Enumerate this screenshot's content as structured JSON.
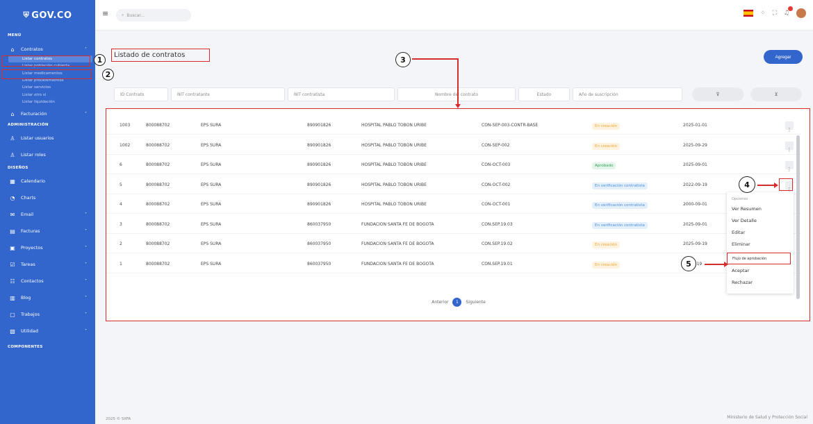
{
  "brand": {
    "name": "GOV.CO",
    "icon": "gov-shield-icon"
  },
  "sidebar": {
    "sections": {
      "menu": "MENÚ",
      "admin": "ADMINISTRACIÓN",
      "designs": "DISEÑOS",
      "components": "COMPONENTES"
    },
    "contratos": "Contratos",
    "subitems": [
      "Listar contratos",
      "Listar población cubierta",
      "Listar medicamentos",
      "Listar procedimientos",
      "Listar servicios",
      "Listar otro si",
      "Listar liquidación"
    ],
    "facturacion": "Facturación",
    "admin_items": [
      "Listar usuarios",
      "Listar roles"
    ],
    "design_items": [
      "Calendario",
      "Charts",
      "Email",
      "Facturas",
      "Proyectos",
      "Tareas",
      "Contactos",
      "Blog",
      "Trabajos",
      "Utilidad"
    ]
  },
  "topbar": {
    "search_placeholder": "Buscar..."
  },
  "page": {
    "title": "Listado de contratos",
    "add_button": "Agregar"
  },
  "filters": [
    "ID Contrato",
    "NIT contratante",
    "NIT contratista",
    "Nombre del contrato",
    "Estado",
    "Año de suscripción"
  ],
  "table": {
    "rows": [
      {
        "id": "1003",
        "nit1": "800088702",
        "contratante": "EPS SURA",
        "nit2": "890901826",
        "nombre": "HOSPITAL PABLO TOBON URIBE",
        "codigo": "CON-SEP-003-CONTR-BASE",
        "estado": "En creación",
        "estado_color": "#f0a63a",
        "estado_bg": "#fff3df",
        "fecha": "2025-01-01"
      },
      {
        "id": "1002",
        "nit1": "800088702",
        "contratante": "EPS SURA",
        "nit2": "890901826",
        "nombre": "HOSPITAL PABLO TOBON URIBE",
        "codigo": "CON-SEP-002",
        "estado": "En creación",
        "estado_color": "#f0a63a",
        "estado_bg": "#fff3df",
        "fecha": "2025-09-29"
      },
      {
        "id": "6",
        "nit1": "800088702",
        "contratante": "EPS SURA",
        "nit2": "890901826",
        "nombre": "HOSPITAL PABLO TOBON URIBE",
        "codigo": "CON-OCT-003",
        "estado": "Aprobado",
        "estado_color": "#3aa35c",
        "estado_bg": "#e3f5e9",
        "fecha": "2025-09-01"
      },
      {
        "id": "5",
        "nit1": "800088702",
        "contratante": "EPS SURA",
        "nit2": "890901826",
        "nombre": "HOSPITAL PABLO TOBON URIBE",
        "codigo": "CON-OCT-002",
        "estado": "En verificación contratista",
        "estado_color": "#4a8fe0",
        "estado_bg": "#e4effc",
        "fecha": "2022-09-19"
      },
      {
        "id": "4",
        "nit1": "800088702",
        "contratante": "EPS SURA",
        "nit2": "890901826",
        "nombre": "HOSPITAL PABLO TOBON URIBE",
        "codigo": "CON-OCT-001",
        "estado": "En verificación contratista",
        "estado_color": "#4a8fe0",
        "estado_bg": "#e4effc",
        "fecha": "2000-09-01"
      },
      {
        "id": "3",
        "nit1": "800088702",
        "contratante": "EPS SURA",
        "nit2": "860037950",
        "nombre": "FUNDACION SANTA FE DE BOGOTA",
        "codigo": "CON.SEP.19.03",
        "estado": "En verificación contratista",
        "estado_color": "#4a8fe0",
        "estado_bg": "#e4effc",
        "fecha": "2025-09-01"
      },
      {
        "id": "2",
        "nit1": "800088702",
        "contratante": "EPS SURA",
        "nit2": "860037950",
        "nombre": "FUNDACION SANTA FE DE BOGOTA",
        "codigo": "CON.SEP.19.02",
        "estado": "En creación",
        "estado_color": "#f0a63a",
        "estado_bg": "#fff3df",
        "fecha": "2025-09-19"
      },
      {
        "id": "1",
        "nit1": "800088702",
        "contratante": "EPS SURA",
        "nit2": "860037950",
        "nombre": "FUNDACION SANTA FE DE BOGOTA",
        "codigo": "CON.SEP.19.01",
        "estado": "En creación",
        "estado_color": "#f0a63a",
        "estado_bg": "#fff3df",
        "fecha": "25-09-19"
      }
    ]
  },
  "pager": {
    "prev": "Anterior",
    "page": "1",
    "next": "Siguiente"
  },
  "dropdown": {
    "header": "Opciones",
    "items": [
      "Ver Resumen",
      "Ver Detalle",
      "Editar",
      "Eliminar",
      "Flujo de aprobación",
      "Aceptar",
      "Rechazar"
    ]
  },
  "annotations": [
    "1",
    "2",
    "3",
    "4",
    "5"
  ],
  "footer": {
    "left": "2025 © SIIFA",
    "right": "Ministerio de Salud y Protección Social"
  },
  "colors": {
    "primary": "#3366cc",
    "highlight": "#d82b2b"
  }
}
